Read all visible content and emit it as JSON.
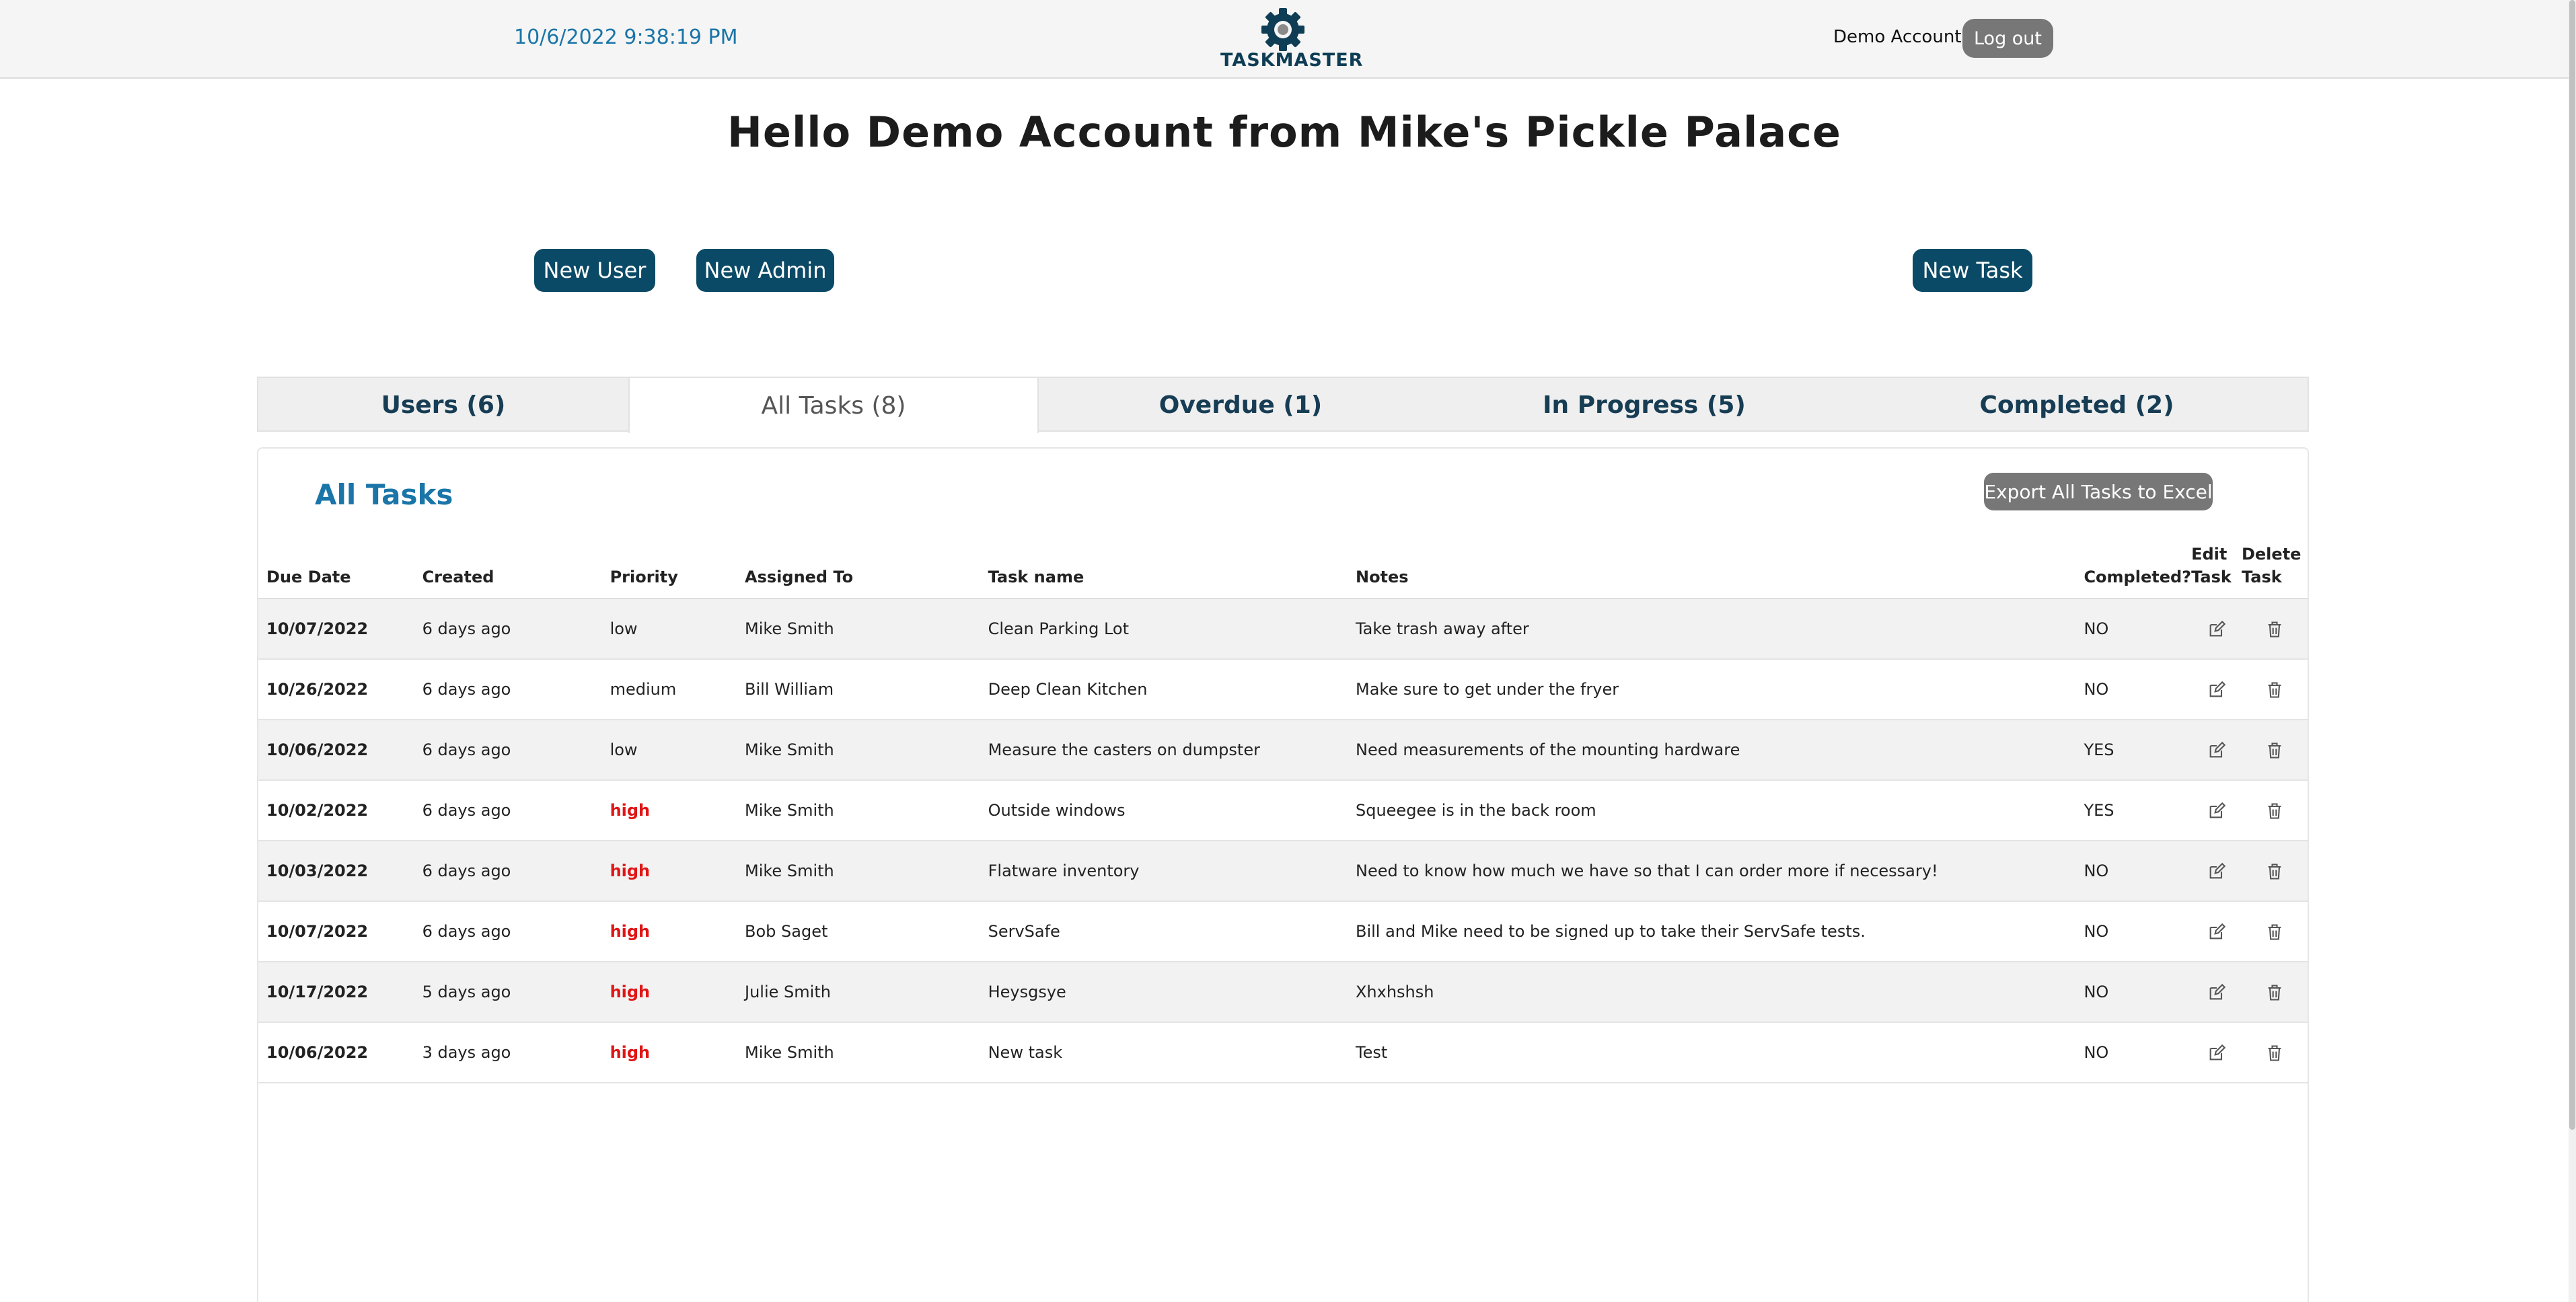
{
  "header": {
    "datetime": "10/6/2022 9:38:19 PM",
    "logo_text": "TASKMASTER",
    "account_name": "Demo Account",
    "logout_label": "Log out"
  },
  "greeting": "Hello Demo Account from Mike's Pickle Palace",
  "actions": {
    "new_user": "New User",
    "new_admin": "New Admin",
    "new_task": "New Task"
  },
  "tabs": [
    {
      "label": "Users (6)",
      "active": false
    },
    {
      "label": "All Tasks (8)",
      "active": true
    },
    {
      "label": "Overdue (1)",
      "active": false
    },
    {
      "label": "In Progress (5)",
      "active": false
    },
    {
      "label": "Completed (2)",
      "active": false
    }
  ],
  "panel": {
    "title": "All Tasks",
    "export_label": "Export All Tasks to Excel"
  },
  "table": {
    "columns": [
      "Due Date",
      "Created",
      "Priority",
      "Assigned To",
      "Task name",
      "Notes",
      "Completed?",
      "Edit Task",
      "Delete Task"
    ],
    "rows": [
      {
        "due": "10/07/2022",
        "created": "6 days ago",
        "priority": "low",
        "assigned": "Mike Smith",
        "task": "Clean Parking Lot",
        "notes": "Take trash away after",
        "completed": "NO"
      },
      {
        "due": "10/26/2022",
        "created": "6 days ago",
        "priority": "medium",
        "assigned": "Bill William",
        "task": "Deep Clean Kitchen",
        "notes": "Make sure to get under the fryer",
        "completed": "NO"
      },
      {
        "due": "10/06/2022",
        "created": "6 days ago",
        "priority": "low",
        "assigned": "Mike Smith",
        "task": "Measure the casters on dumpster",
        "notes": "Need measurements of the mounting hardware",
        "completed": "YES"
      },
      {
        "due": "10/02/2022",
        "created": "6 days ago",
        "priority": "high",
        "assigned": "Mike Smith",
        "task": "Outside windows",
        "notes": "Squeegee is in the back room",
        "completed": "YES"
      },
      {
        "due": "10/03/2022",
        "created": "6 days ago",
        "priority": "high",
        "assigned": "Mike Smith",
        "task": "Flatware inventory",
        "notes": "Need to know how much we have so that I can order more if necessary!",
        "completed": "NO"
      },
      {
        "due": "10/07/2022",
        "created": "6 days ago",
        "priority": "high",
        "assigned": "Bob Saget",
        "task": "ServSafe",
        "notes": "Bill and Mike need to be signed up to take their ServSafe tests.",
        "completed": "NO"
      },
      {
        "due": "10/17/2022",
        "created": "5 days ago",
        "priority": "high",
        "assigned": "Julie Smith",
        "task": "Heysgsye",
        "notes": "Xhxhshsh",
        "completed": "NO"
      },
      {
        "due": "10/06/2022",
        "created": "3 days ago",
        "priority": "high",
        "assigned": "Mike Smith",
        "task": "New task",
        "notes": "Test",
        "completed": "NO"
      }
    ]
  },
  "colors": {
    "primary_button": "#0b4a66",
    "accent_text": "#1a75a8",
    "high_priority": "#e01515",
    "grey_button": "#777777"
  },
  "icons": {
    "logo": "gear-icon",
    "edit": "edit-icon",
    "delete": "trash-icon"
  }
}
